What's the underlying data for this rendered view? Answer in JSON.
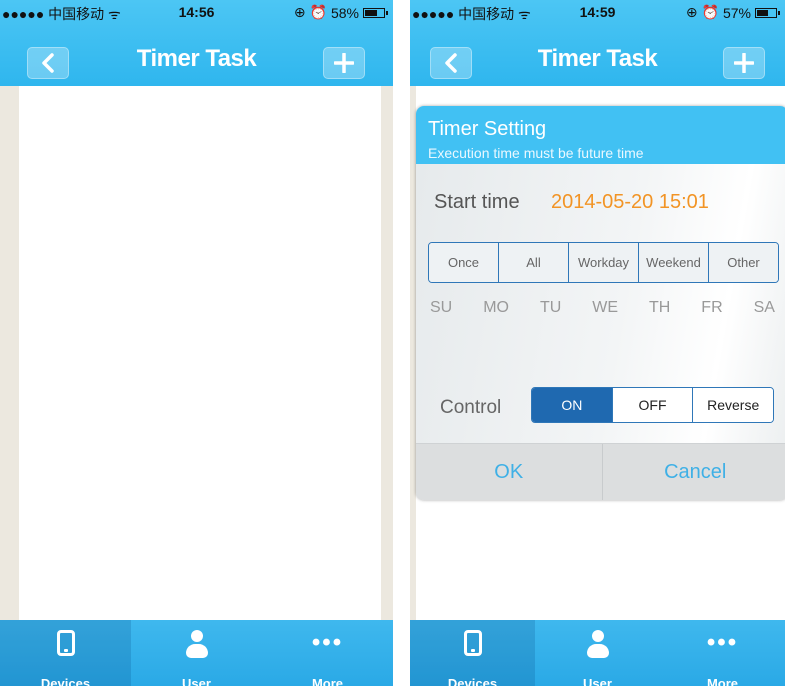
{
  "screens": [
    {
      "status": {
        "carrier": "●●●●● 中国移动 ᯤ",
        "time": "14:56",
        "icons": "⊕ ⏰",
        "battery": "58%",
        "battery_level": 0.58
      },
      "header": {
        "title": "Timer Task",
        "back_icon": "chevron-left-icon",
        "add_icon": "plus-icon"
      },
      "tabs": [
        {
          "label": "Devices",
          "icon": "phone-icon",
          "active": true
        },
        {
          "label": "User",
          "icon": "user-icon",
          "active": false
        },
        {
          "label": "More",
          "icon": "more-icon",
          "active": false
        }
      ]
    },
    {
      "status": {
        "carrier": "●●●●● 中国移动 ᯤ",
        "time": "14:59",
        "icons": "⊕ ⏰",
        "battery": "57%",
        "battery_level": 0.57
      },
      "header": {
        "title": "Timer Task",
        "back_icon": "chevron-left-icon",
        "add_icon": "plus-icon"
      },
      "tabs": [
        {
          "label": "Devices",
          "icon": "phone-icon",
          "active": true
        },
        {
          "label": "User",
          "icon": "user-icon",
          "active": false
        },
        {
          "label": "More",
          "icon": "more-icon",
          "active": false
        }
      ],
      "dialog": {
        "title": "Timer Setting",
        "subtitle": "Execution time must be future time",
        "start_time_label": "Start time",
        "start_time_value": "2014-05-20 15:01",
        "repeat_options": [
          "Once",
          "All",
          "Workday",
          "Weekend",
          "Other"
        ],
        "days": [
          "SU",
          "MO",
          "TU",
          "WE",
          "TH",
          "FR",
          "SA"
        ],
        "control_label": "Control",
        "control_options": [
          "ON",
          "OFF",
          "Reverse"
        ],
        "control_selected": "ON",
        "ok_label": "OK",
        "cancel_label": "Cancel"
      }
    }
  ],
  "colors": {
    "header": "#2fb6ee",
    "accent_orange": "#f29425",
    "control_on": "#1f69b0",
    "dialog_button": "#3fb0e6"
  }
}
